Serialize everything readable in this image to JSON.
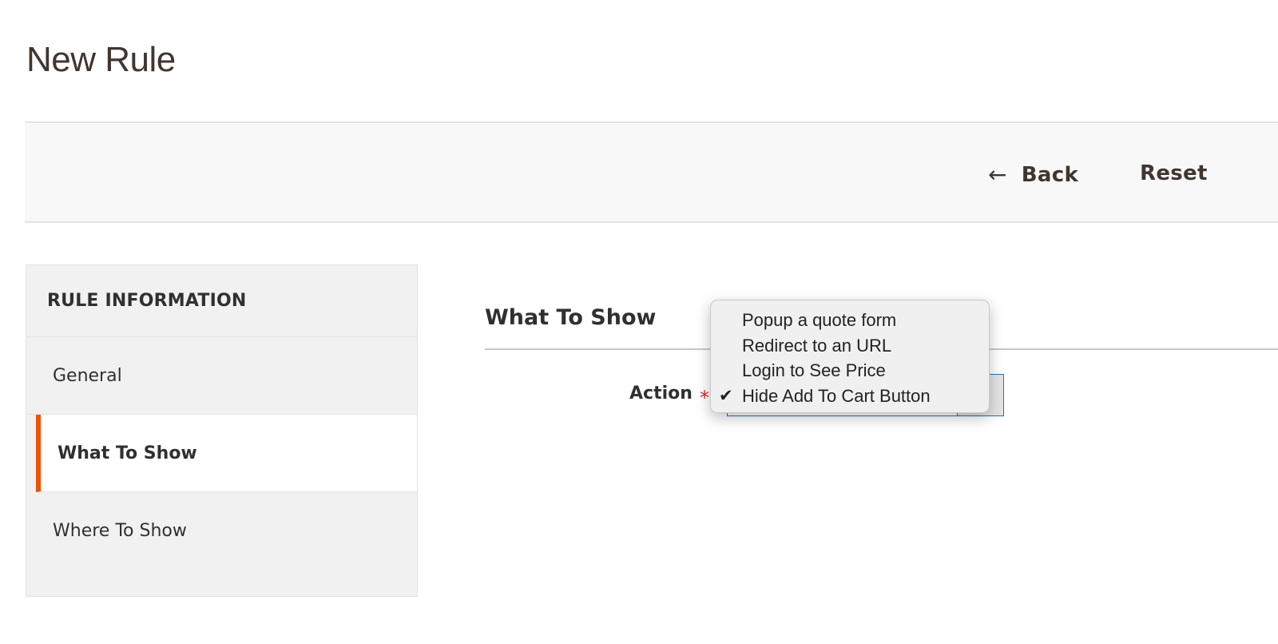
{
  "page": {
    "title": "New Rule"
  },
  "toolbar": {
    "back_icon": "arrow-left-icon",
    "back_glyph": "←",
    "back_label": "Back",
    "reset_label": "Reset"
  },
  "sidebar": {
    "title": "RULE INFORMATION",
    "items": [
      {
        "label": "General",
        "active": false
      },
      {
        "label": "What To Show",
        "active": true
      },
      {
        "label": "Where To Show",
        "active": false
      }
    ],
    "accent_color": "#eb5202"
  },
  "main": {
    "section_title": "What To Show",
    "action_field": {
      "label": "Action",
      "required_marker": "*",
      "selected_value": "Hide Add To Cart Button",
      "options": [
        {
          "label": "Popup a quote form",
          "selected": false
        },
        {
          "label": "Redirect to an URL",
          "selected": false
        },
        {
          "label": "Login to See Price",
          "selected": false
        },
        {
          "label": "Hide Add To Cart Button",
          "selected": true
        }
      ],
      "check_glyph": "✔",
      "check_icon": "checkmark-icon"
    }
  }
}
